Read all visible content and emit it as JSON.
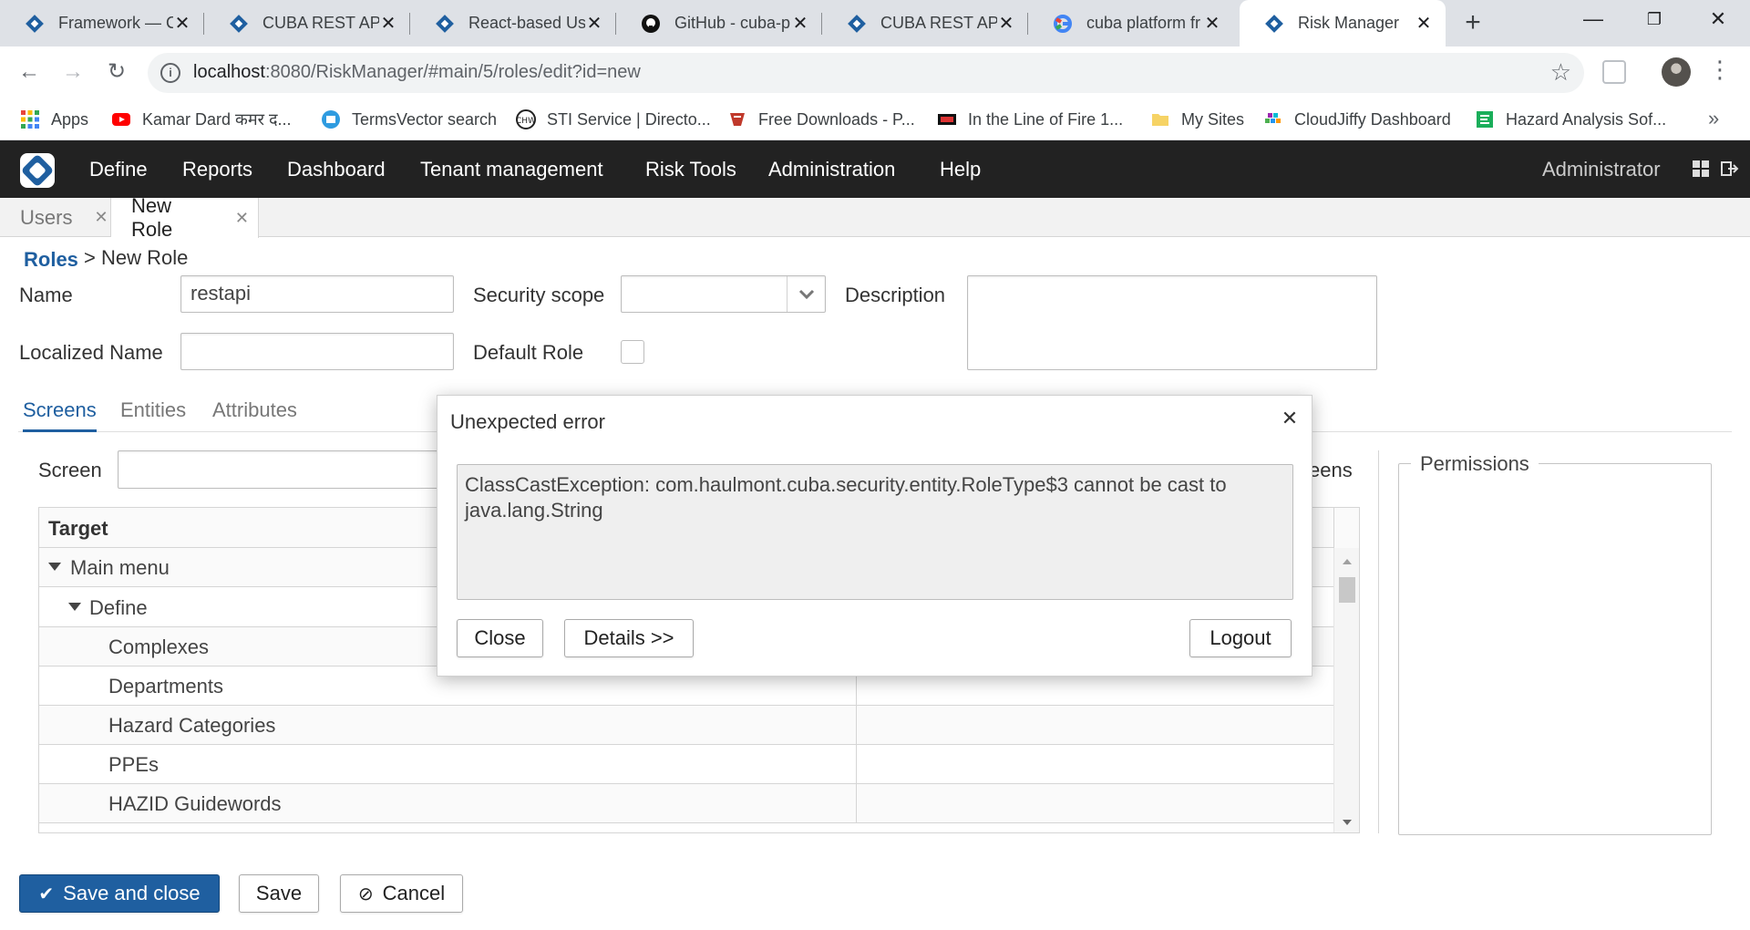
{
  "browser": {
    "tabs": [
      {
        "title": "Framework — C"
      },
      {
        "title": "CUBA REST API"
      },
      {
        "title": "React-based Use"
      },
      {
        "title": "GitHub - cuba-p"
      },
      {
        "title": "CUBA REST API"
      },
      {
        "title": "cuba platform fr"
      },
      {
        "title": "Risk Manager"
      }
    ],
    "url_host": "localhost",
    "url_rest": ":8080/RiskManager/#main/5/roles/edit?id=new",
    "bookmarks": [
      {
        "label": "Apps"
      },
      {
        "label": "Kamar Dard कमर द..."
      },
      {
        "label": "TermsVector search"
      },
      {
        "label": "STI Service | Directo..."
      },
      {
        "label": "Free Downloads - P..."
      },
      {
        "label": "In the Line of Fire 1..."
      },
      {
        "label": "My Sites"
      },
      {
        "label": "CloudJiffy Dashboard"
      },
      {
        "label": "Hazard Analysis Sof..."
      }
    ],
    "bookmarks_more": "»"
  },
  "app": {
    "menu": [
      "Define",
      "Reports",
      "Dashboard",
      "Tenant management",
      "Risk Tools",
      "Administration",
      "Help"
    ],
    "user": "Administrator",
    "tabs": [
      {
        "label": "Users"
      },
      {
        "label": "New Role"
      }
    ],
    "breadcrumb": {
      "link": "Roles",
      "current": "> New Role"
    }
  },
  "form": {
    "name_label": "Name",
    "name_value": "restapi",
    "localized_label": "Localized Name",
    "localized_value": "",
    "scope_label": "Security scope",
    "scope_value": "",
    "default_label": "Default Role",
    "description_label": "Description",
    "description_value": ""
  },
  "subtabs": [
    "Screens",
    "Entities",
    "Attributes"
  ],
  "screens": {
    "filter_label": "Screen",
    "filter_value": "",
    "right_label_fragment": "eens",
    "column_target": "Target",
    "rows": [
      {
        "label": "Main menu"
      },
      {
        "label": "Define"
      },
      {
        "label": "Complexes"
      },
      {
        "label": "Departments"
      },
      {
        "label": "Hazard Categories"
      },
      {
        "label": "PPEs"
      },
      {
        "label": "HAZID Guidewords"
      }
    ],
    "permissions_label": "Permissions"
  },
  "buttons": {
    "save_close": "Save and close",
    "save": "Save",
    "cancel": "Cancel"
  },
  "dialog": {
    "title": "Unexpected error",
    "message": "ClassCastException: com.haulmont.cuba.security.entity.RoleType$3 cannot be cast to java.lang.String",
    "close": "Close",
    "details": "Details >>",
    "logout": "Logout"
  },
  "colors": {
    "brand": "#1f5fa0",
    "header_bg": "#222222"
  }
}
